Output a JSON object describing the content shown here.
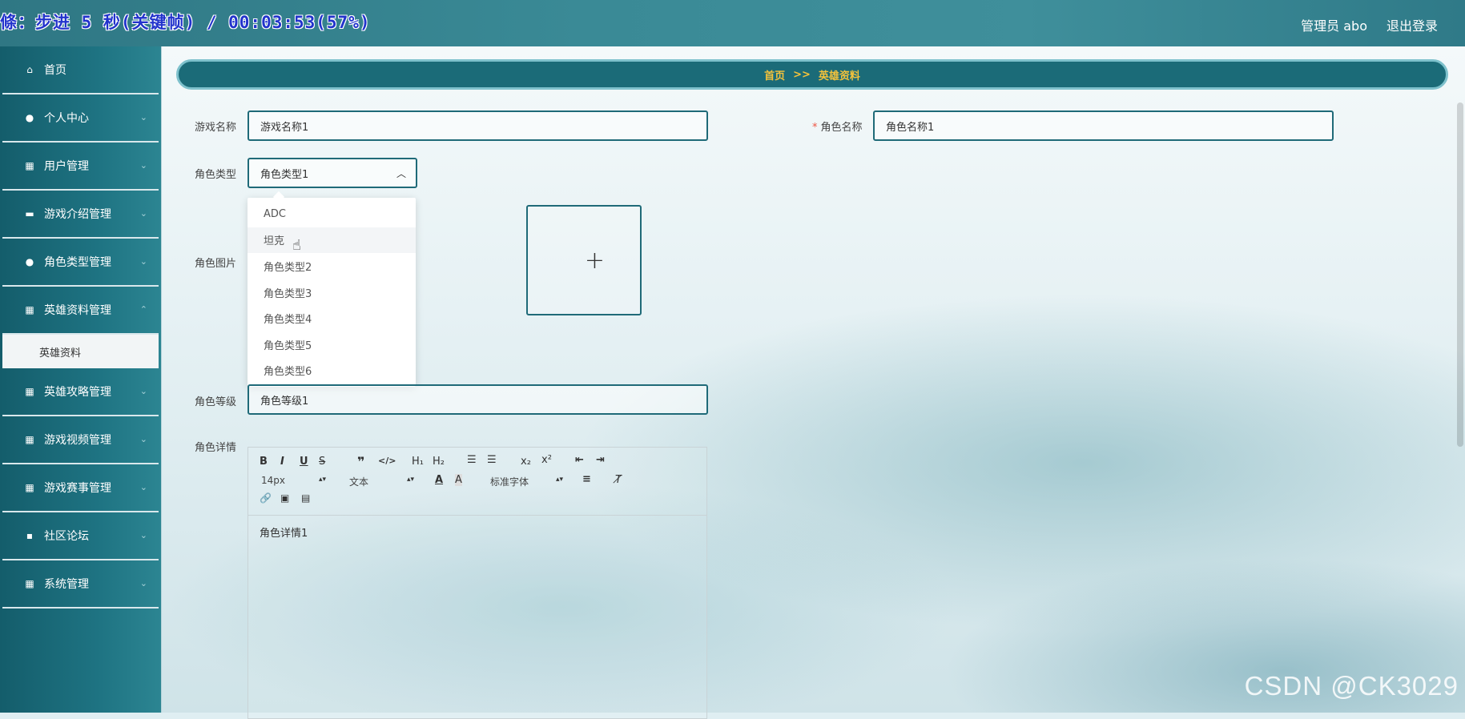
{
  "overlay": {
    "recording_text": "條：步进 5 秒(关键帧) / 00:03:53(57%)"
  },
  "header": {
    "user_label": "管理员 abo",
    "logout_label": "退出登录"
  },
  "sidebar": {
    "items": [
      {
        "label": "首页",
        "icon": "home-icon"
      },
      {
        "label": "个人中心",
        "icon": "user-icon"
      },
      {
        "label": "用户管理",
        "icon": "grid-icon"
      },
      {
        "label": "游戏介绍管理",
        "icon": "chat-icon"
      },
      {
        "label": "角色类型管理",
        "icon": "person-icon"
      },
      {
        "label": "英雄资料管理",
        "icon": "grid-icon"
      },
      {
        "label": "英雄攻略管理",
        "icon": "grid-icon"
      },
      {
        "label": "游戏视频管理",
        "icon": "grid-icon"
      },
      {
        "label": "游戏赛事管理",
        "icon": "grid-icon"
      },
      {
        "label": "社区论坛",
        "icon": "forum-icon"
      },
      {
        "label": "系统管理",
        "icon": "grid-icon"
      }
    ],
    "submenu": {
      "label": "英雄资料"
    }
  },
  "breadcrumb": {
    "home": "首页",
    "sep": ">>",
    "current": "英雄资料"
  },
  "form": {
    "game_name": {
      "label": "游戏名称",
      "value": "游戏名称1"
    },
    "role_name": {
      "label": "角色名称",
      "required_mark": "*",
      "value": "角色名称1"
    },
    "role_type": {
      "label": "角色类型",
      "value": "角色类型1"
    },
    "role_image": {
      "label": "角色图片"
    },
    "role_level": {
      "label": "角色等级",
      "value": "角色等级1"
    },
    "role_detail": {
      "label": "角色详情",
      "content": "角色详情1"
    }
  },
  "dropdown": {
    "options": [
      "ADC",
      "坦克",
      "角色类型2",
      "角色类型3",
      "角色类型4",
      "角色类型5",
      "角色类型6"
    ],
    "hovered_index": 1
  },
  "editor_toolbar": {
    "font_size": "14px",
    "text_style": "文本",
    "font_family": "标准字体"
  },
  "watermark": "CSDN @CK3029"
}
